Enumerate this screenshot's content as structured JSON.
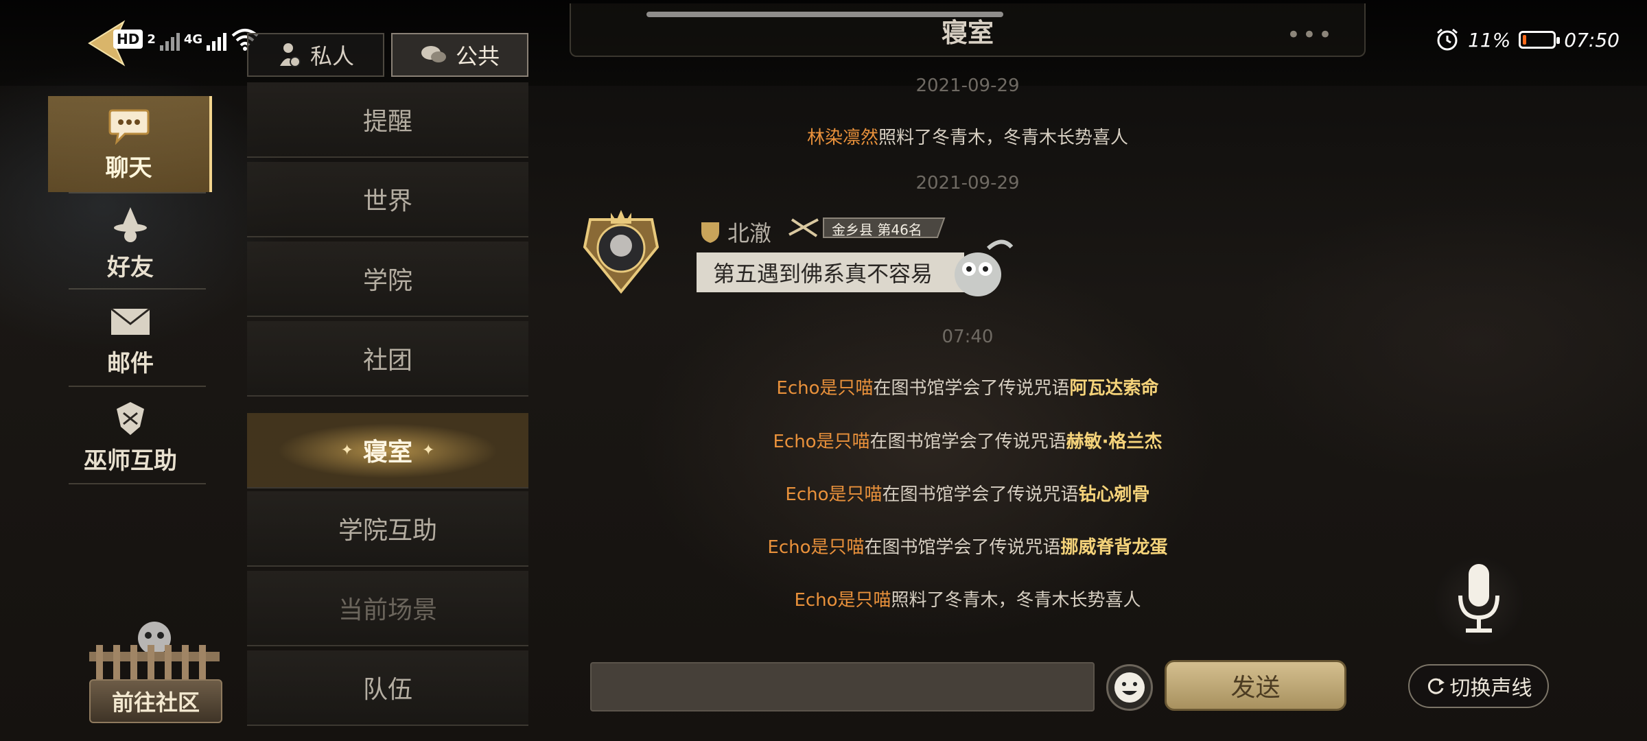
{
  "status_bar": {
    "hd": "HD",
    "sim": "2",
    "network": "4G",
    "battery_pct": "11%",
    "time": "07:50",
    "battery_level": 0.11
  },
  "top_tabs": {
    "private": "私人",
    "public": "公共",
    "active": "public"
  },
  "header": {
    "title": "寝室",
    "more": "•••"
  },
  "rail": {
    "items": [
      {
        "label": "聊天",
        "icon": "chat-bubble-icon",
        "active": true
      },
      {
        "label": "好友",
        "icon": "witch-hat-icon",
        "active": false
      },
      {
        "label": "邮件",
        "icon": "envelope-icon",
        "active": false
      },
      {
        "label": "巫师互助",
        "icon": "crest-icon",
        "active": false
      }
    ],
    "community": "前往社区"
  },
  "channels": [
    {
      "label": "提醒"
    },
    {
      "label": "世界"
    },
    {
      "label": "学院"
    },
    {
      "label": "社团"
    },
    {
      "label": "寝室",
      "active": true
    },
    {
      "label": "学院互助"
    },
    {
      "label": "当前场景",
      "dim": true
    },
    {
      "label": "队伍"
    }
  ],
  "chat": {
    "date1": "2021-09-29",
    "msg1": {
      "name": "林染凛然",
      "text": "照料了冬青木，冬青木长势喜人"
    },
    "date2": "2021-09-29",
    "user": {
      "name": "北澈",
      "badge": "金乡县 第46名",
      "message": "第五遇到佛系真不容易"
    },
    "time": "07:40",
    "spell_msgs": [
      {
        "name": "Echo是只喵",
        "text": "在图书馆学会了传说咒语",
        "spell": "阿瓦达索命"
      },
      {
        "name": "Echo是只喵",
        "text": "在图书馆学会了传说咒语",
        "spell": "赫敏·格兰杰"
      },
      {
        "name": "Echo是只喵",
        "text": "在图书馆学会了传说咒语",
        "spell": "钻心剜骨"
      },
      {
        "name": "Echo是只喵",
        "text": "在图书馆学会了传说咒语",
        "spell": "挪威脊背龙蛋"
      }
    ],
    "last_msg": {
      "name": "Echo是只喵",
      "text": "照料了冬青木，冬青木长势喜人"
    }
  },
  "input": {
    "value": "",
    "send": "发送"
  },
  "voice": {
    "switch": "切换声线"
  },
  "colors": {
    "accent_gold": "#f5d37a",
    "name_orange": "#e9913b",
    "battery_low": "#ff6a1a"
  }
}
